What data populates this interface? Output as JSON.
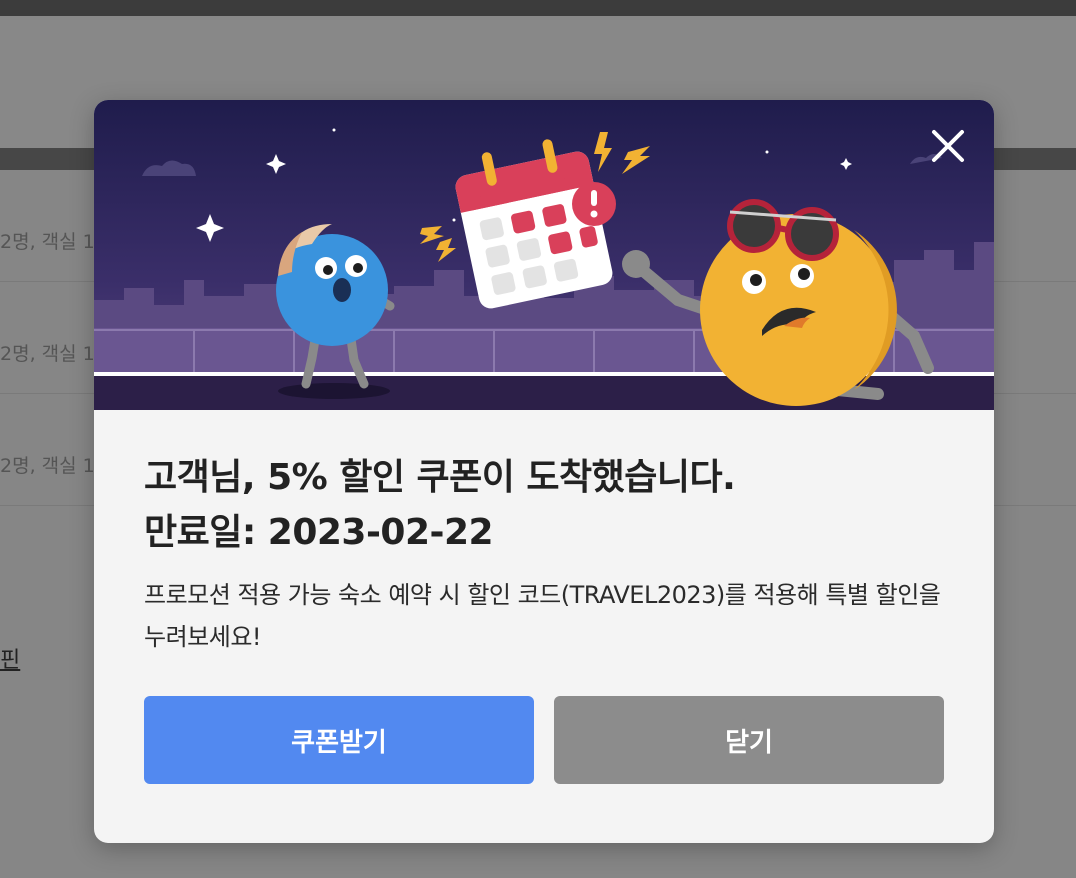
{
  "background": {
    "rows": [
      {
        "text": "2명, 객실 1"
      },
      {
        "text": "2명, 객실 1"
      },
      {
        "text": "2명, 객실 1"
      }
    ],
    "link_fragment": "핀"
  },
  "modal": {
    "close_icon": "close-icon",
    "title_line1": "고객님, 5% 할인 쿠폰이 도착했습니다.",
    "title_line2": "만료일: 2023-02-22",
    "description": "프로모션 적용 가능 숙소 예약 시 할인 코드(TRAVEL2023)를 적용해 특별 할인을 누려보세요!",
    "primary_button": "쿠폰받기",
    "secondary_button": "닫기"
  },
  "colors": {
    "primary": "#5289f0",
    "secondary": "#8c8c8c",
    "banner_sky": "#2a2458",
    "character_blue": "#3a93dd",
    "character_yellow": "#f2b233"
  }
}
